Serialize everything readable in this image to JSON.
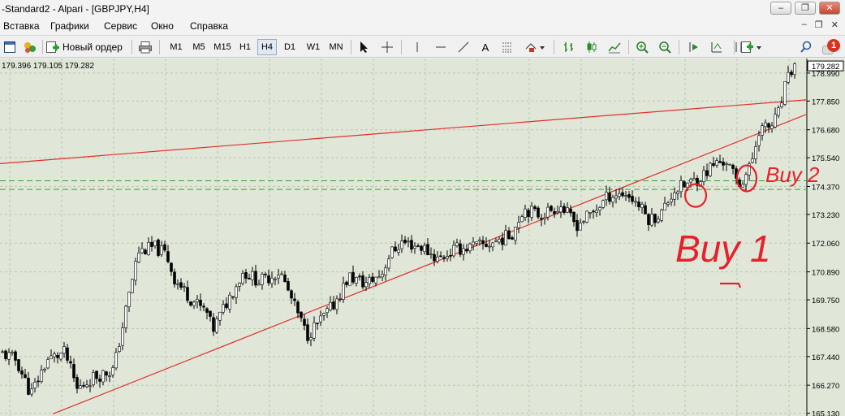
{
  "window": {
    "title": "-Standard2 - Alpari - [GBPJPY,H4]",
    "minimize": "–",
    "restore": "❐",
    "close": "✕"
  },
  "mdi": {
    "minimize": "–",
    "restore": "❐",
    "close": "✕"
  },
  "menu": [
    "Вставка",
    "Графики",
    "Сервис",
    "Окно",
    "Справка"
  ],
  "toolbar": {
    "new_order": "Новый ордер",
    "timeframes": [
      "M1",
      "M5",
      "M15",
      "H1",
      "H4",
      "D1",
      "W1",
      "MN"
    ],
    "selected_timeframe": "H4",
    "text_tool": "A",
    "notification_count": "1"
  },
  "chart": {
    "ohlc_header": "179.396 179.105 179.282",
    "current_price": "179.282",
    "colors": {
      "background": "#e0e7d9",
      "grid": "#b9c7b1",
      "candle": "#000000",
      "trendline": "#e0302a",
      "level": "#35a035",
      "annotation": "#e8202a"
    }
  },
  "chart_data": {
    "type": "candlestick",
    "symbol": "GBPJPY",
    "timeframe": "H4",
    "ylim": [
      165.0,
      179.7
    ],
    "y_ticks": [
      179.282,
      178.99,
      177.85,
      176.68,
      175.54,
      174.37,
      173.23,
      172.06,
      170.89,
      169.75,
      168.58,
      167.44,
      166.27,
      165.13
    ],
    "y_tick_labels": [
      "179.282",
      "178.990",
      "177.850",
      "176.680",
      "175.540",
      "174.370",
      "173.230",
      "172.060",
      "170.890",
      "169.750",
      "168.580",
      "167.440",
      "166.270",
      "165.130"
    ],
    "close_anchors": [
      [
        0,
        167.6
      ],
      [
        20,
        167.3
      ],
      [
        38,
        165.9
      ],
      [
        58,
        167.3
      ],
      [
        80,
        167.6
      ],
      [
        95,
        166.1
      ],
      [
        115,
        166.6
      ],
      [
        140,
        166.9
      ],
      [
        158,
        169.8
      ],
      [
        170,
        171.7
      ],
      [
        190,
        171.9
      ],
      [
        205,
        171.6
      ],
      [
        215,
        170.6
      ],
      [
        235,
        169.8
      ],
      [
        255,
        169.2
      ],
      [
        262,
        168.5
      ],
      [
        280,
        169.7
      ],
      [
        300,
        170.9
      ],
      [
        320,
        170.5
      ],
      [
        345,
        170.9
      ],
      [
        360,
        169.7
      ],
      [
        378,
        168.3
      ],
      [
        395,
        168.9
      ],
      [
        410,
        169.5
      ],
      [
        430,
        170.7
      ],
      [
        450,
        170.4
      ],
      [
        470,
        170.8
      ],
      [
        480,
        171.6
      ],
      [
        495,
        172.1
      ],
      [
        520,
        171.9
      ],
      [
        540,
        171.4
      ],
      [
        560,
        171.8
      ],
      [
        580,
        171.9
      ],
      [
        600,
        172.0
      ],
      [
        630,
        172.4
      ],
      [
        645,
        173.5
      ],
      [
        665,
        173.2
      ],
      [
        690,
        173.6
      ],
      [
        710,
        172.8
      ],
      [
        730,
        173.3
      ],
      [
        750,
        174.0
      ],
      [
        770,
        174.1
      ],
      [
        785,
        173.7
      ],
      [
        800,
        173.0
      ],
      [
        815,
        173.3
      ],
      [
        830,
        174.2
      ],
      [
        850,
        174.5
      ],
      [
        865,
        174.8
      ],
      [
        880,
        175.3
      ],
      [
        895,
        175.4
      ],
      [
        910,
        174.4
      ],
      [
        925,
        175.2
      ],
      [
        935,
        176.7
      ],
      [
        950,
        176.8
      ],
      [
        960,
        177.4
      ],
      [
        967,
        178.4
      ],
      [
        975,
        179.1
      ],
      [
        981,
        179.282
      ]
    ],
    "trendlines": [
      {
        "name": "upper",
        "from": [
          0,
          175.3
        ],
        "to": [
          993,
          177.9
        ]
      },
      {
        "name": "lower",
        "from": [
          65,
          165.1
        ],
        "to": [
          993,
          177.3
        ]
      }
    ],
    "levels": [
      174.6,
      174.25
    ],
    "annotations": [
      {
        "text": "Buy 1",
        "price": 171.9
      },
      {
        "text": "Buy 2",
        "price": 175.2
      }
    ]
  }
}
